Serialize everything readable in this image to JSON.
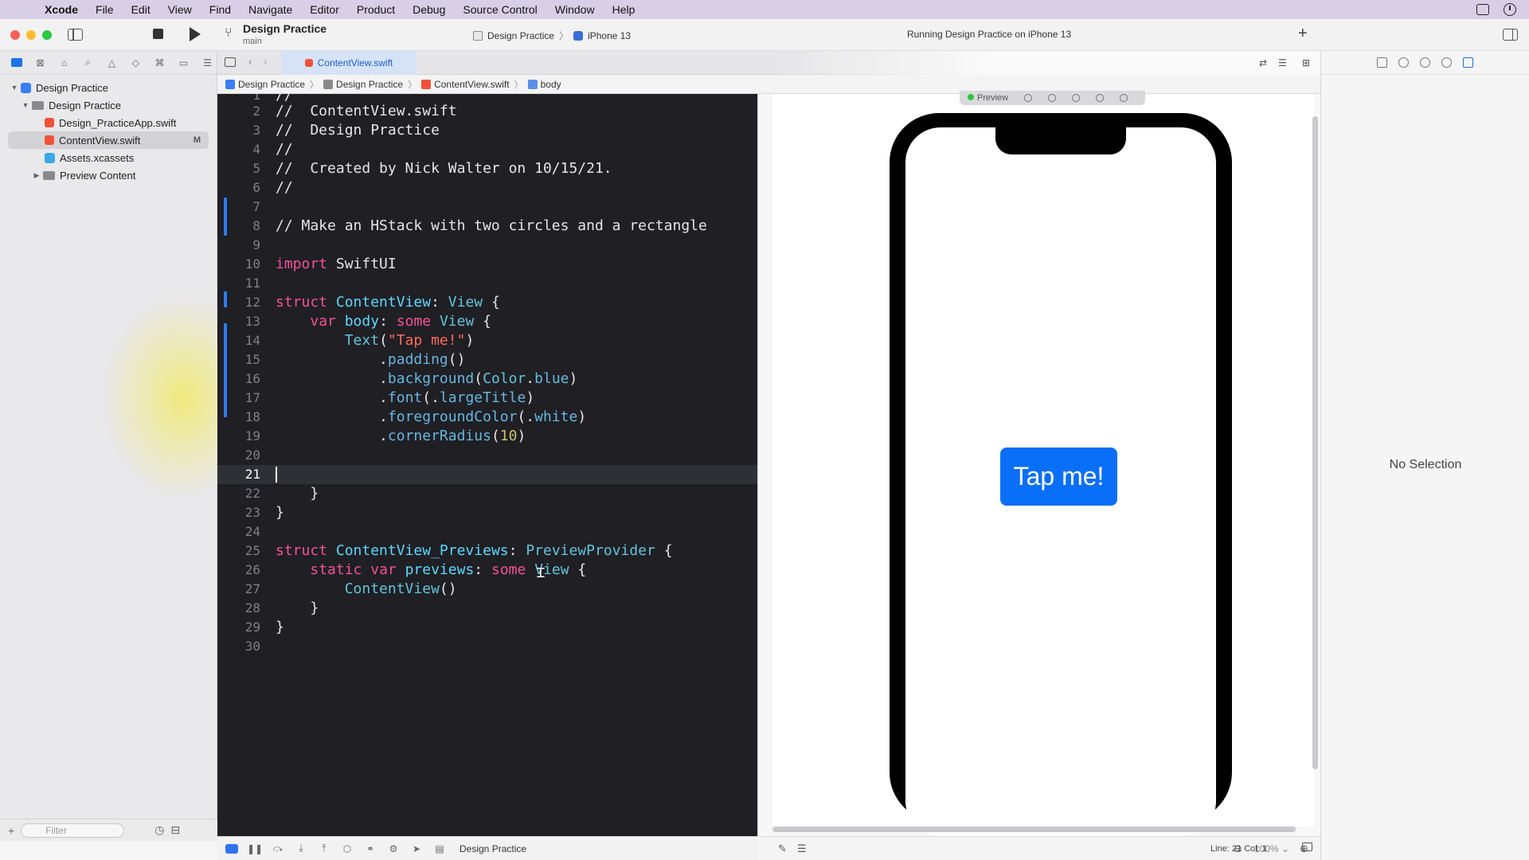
{
  "menubar": {
    "app": "Xcode",
    "items": [
      "File",
      "Edit",
      "View",
      "Find",
      "Navigate",
      "Editor",
      "Product",
      "Debug",
      "Source Control",
      "Window",
      "Help"
    ]
  },
  "toolbar": {
    "project_title": "Design Practice",
    "branch": "main",
    "scheme": "Design Practice",
    "device": "iPhone 13",
    "status": "Running Design Practice on iPhone 13"
  },
  "navigator": {
    "tree": [
      {
        "label": "Design Practice",
        "kind": "project"
      },
      {
        "label": "Design Practice",
        "kind": "group"
      },
      {
        "label": "Design_PracticeApp.swift",
        "kind": "swift"
      },
      {
        "label": "ContentView.swift",
        "kind": "swift",
        "badge": "M",
        "selected": true
      },
      {
        "label": "Assets.xcassets",
        "kind": "assets"
      },
      {
        "label": "Preview Content",
        "kind": "group"
      }
    ],
    "filter_placeholder": "Filter"
  },
  "editor": {
    "tab": "ContentView.swift",
    "jumpbar": [
      "Design Practice",
      "Design Practice",
      "ContentView.swift",
      "body"
    ],
    "current_line": 21,
    "lines": [
      "//",
      "//  ContentView.swift",
      "//  Design Practice",
      "//",
      "//  Created by Nick Walter on 10/15/21.",
      "//",
      "",
      "// Make an HStack with two circles and a rectangle",
      "",
      "import SwiftUI",
      "",
      "struct ContentView: View {",
      "    var body: some View {",
      "        Text(\"Tap me!\")",
      "            .padding()",
      "            .background(Color.blue)",
      "            .font(.largeTitle)",
      "            .foregroundColor(.white)",
      "            .cornerRadius(10)",
      "",
      "",
      "    }",
      "}",
      "",
      "struct ContentView_Previews: PreviewProvider {",
      "    static var previews: some View {",
      "        ContentView()",
      "    }",
      "}",
      ""
    ]
  },
  "preview": {
    "pill_label": "Preview",
    "button_text": "Tap me!",
    "zoom": "100%"
  },
  "debugbar": {
    "target": "Design Practice"
  },
  "statusbar": {
    "line_col": "Line: 21  Col: 1"
  },
  "inspector": {
    "empty_text": "No Selection"
  },
  "colors": {
    "accent": "#1a73e8",
    "editor_bg": "#1f1f24",
    "button_blue": "#0a6ff8"
  }
}
